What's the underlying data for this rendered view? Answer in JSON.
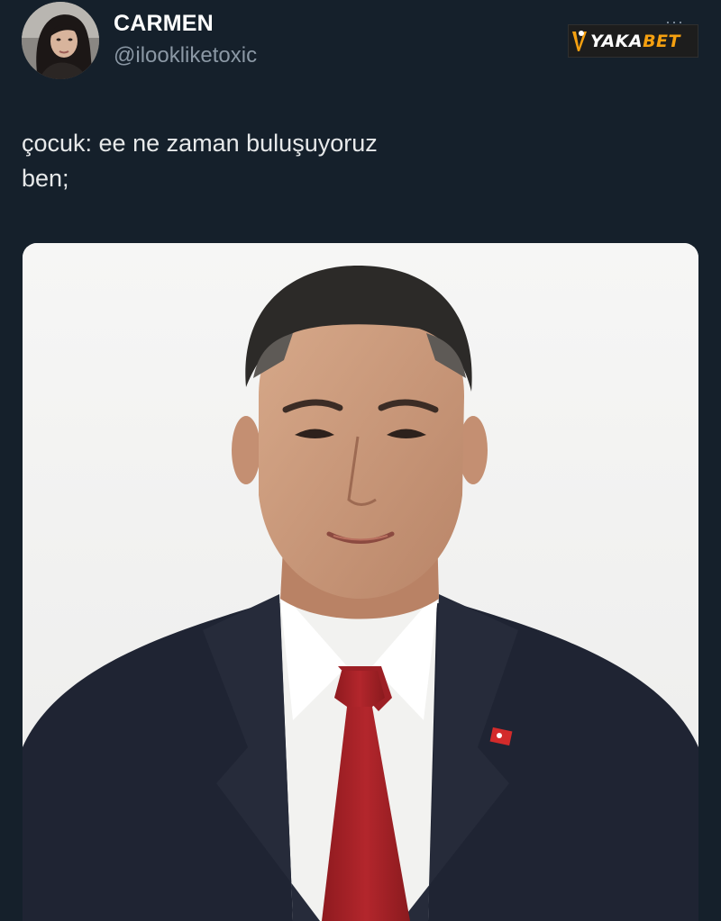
{
  "tweet": {
    "display_name": "CARMEN",
    "handle": "@ilookliketoxic",
    "more_icon": "more-dots-icon",
    "avatar_icon": "avatar",
    "text_lines": [
      "çocuk: ee ne zaman buluşuyoruz",
      "ben;"
    ]
  },
  "watermark": {
    "logo_prefix": "YAKA",
    "logo_suffix": "BET",
    "accent_color": "#f5a010"
  },
  "colors": {
    "background": "#15202b",
    "handle": "#8b98a5",
    "text": "#e7e9ea"
  }
}
